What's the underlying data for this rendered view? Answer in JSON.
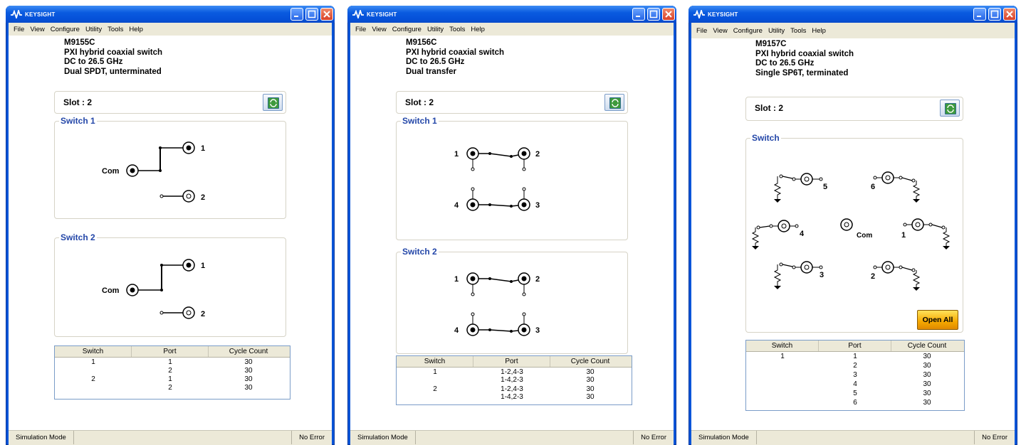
{
  "windows": [
    {
      "logo_text": "KEYSIGHT",
      "menu": [
        "File",
        "View",
        "Configure",
        "Utility",
        "Tools",
        "Help"
      ],
      "model": "M9155C",
      "desc1": "PXI hybrid coaxial switch",
      "desc2": "DC to 26.5 GHz",
      "desc3": "Dual SPDT, unterminated",
      "slot_label": "Slot :  2",
      "groups": [
        "Switch 1",
        "Switch 2"
      ],
      "ports": {
        "com": "Com",
        "p1": "1",
        "p2": "2"
      },
      "table": {
        "headers": [
          "Switch",
          "Port",
          "Cycle Count"
        ],
        "rows": [
          {
            "switch": "1",
            "port": "1",
            "count": "30"
          },
          {
            "switch": "",
            "port": "2",
            "count": "30"
          },
          {
            "switch": "2",
            "port": "1",
            "count": "30"
          },
          {
            "switch": "",
            "port": "2",
            "count": "30"
          }
        ]
      },
      "status_left": "Simulation Mode",
      "status_right": "No Error"
    },
    {
      "logo_text": "KEYSIGHT",
      "menu": [
        "File",
        "View",
        "Configure",
        "Utility",
        "Tools",
        "Help"
      ],
      "model": "M9156C",
      "desc1": "PXI hybrid coaxial switch",
      "desc2": "DC to 26.5 GHz",
      "desc3": "Dual transfer",
      "slot_label": "Slot :  2",
      "groups": [
        "Switch 1",
        "Switch 2"
      ],
      "ports": {
        "p1": "1",
        "p2": "2",
        "p3": "3",
        "p4": "4"
      },
      "table": {
        "headers": [
          "Switch",
          "Port",
          "Cycle Count"
        ],
        "rows": [
          {
            "switch": "1",
            "port": "1-2,4-3",
            "count": "30"
          },
          {
            "switch": "",
            "port": "1-4,2-3",
            "count": "30"
          },
          {
            "switch": "2",
            "port": "1-2,4-3",
            "count": "30"
          },
          {
            "switch": "",
            "port": "1-4,2-3",
            "count": "30"
          }
        ]
      },
      "status_left": "Simulation Mode",
      "status_right": "No Error"
    },
    {
      "logo_text": "KEYSIGHT",
      "menu": [
        "File",
        "View",
        "Configure",
        "Utility",
        "Tools",
        "Help"
      ],
      "model": "M9157C",
      "desc1": "PXI hybrid coaxial switch",
      "desc2": "DC to 26.5 GHz",
      "desc3": "Single SP6T, terminated",
      "slot_label": "Slot :  2",
      "groups": [
        "Switch"
      ],
      "ports": {
        "com": "Com",
        "p1": "1",
        "p2": "2",
        "p3": "3",
        "p4": "4",
        "p5": "5",
        "p6": "6"
      },
      "open_all": "Open All",
      "table": {
        "headers": [
          "Switch",
          "Port",
          "Cycle Count"
        ],
        "rows": [
          {
            "switch": "1",
            "port": "1",
            "count": "30"
          },
          {
            "switch": "",
            "port": "2",
            "count": "30"
          },
          {
            "switch": "",
            "port": "3",
            "count": "30"
          },
          {
            "switch": "",
            "port": "4",
            "count": "30"
          },
          {
            "switch": "",
            "port": "5",
            "count": "30"
          },
          {
            "switch": "",
            "port": "6",
            "count": "30"
          }
        ]
      },
      "status_left": "Simulation Mode",
      "status_right": "No Error"
    }
  ]
}
